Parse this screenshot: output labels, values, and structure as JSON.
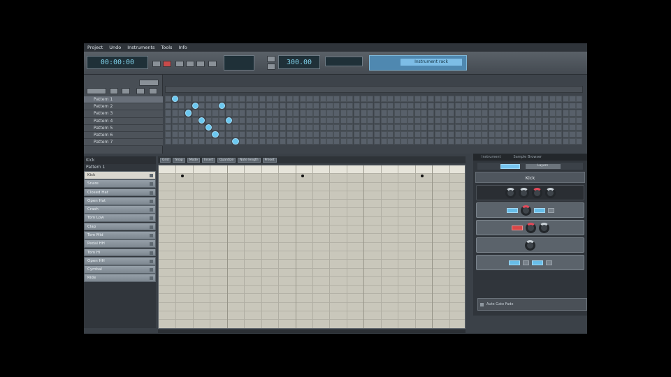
{
  "menu": [
    "Project",
    "Undo",
    "Instruments",
    "Tools",
    "Info"
  ],
  "transport": {
    "time": "00:00:00",
    "tempo": "300.00",
    "current_instrument": "Instrument rack"
  },
  "arranger": {
    "patterns": [
      "Pattern 1",
      "Pattern 2",
      "Pattern 3",
      "Pattern 4",
      "Pattern 5",
      "Pattern 6",
      "Pattern 7"
    ],
    "active_cells": [
      [
        0,
        1
      ],
      [
        1,
        4
      ],
      [
        1,
        8
      ],
      [
        2,
        3
      ],
      [
        3,
        5
      ],
      [
        3,
        9
      ],
      [
        4,
        6
      ],
      [
        5,
        7
      ],
      [
        6,
        10
      ]
    ],
    "columns": 62
  },
  "step_editor": {
    "header": "Kick",
    "pattern_label": "Pattern 1",
    "instruments": [
      "Kick",
      "Snare",
      "Closed Hat",
      "Open Hat",
      "Crash",
      "Tom Low",
      "Clap",
      "Tom Mid",
      "Pedal HH",
      "Tom Hi",
      "Open HH",
      "Cymbal",
      "Ride"
    ],
    "toolbar": [
      "Grid",
      "Snap",
      "Mode",
      "Insert",
      "Quantize",
      "Note length",
      "Preset"
    ],
    "notes": [
      [
        0,
        1
      ],
      [
        0,
        8
      ],
      [
        0,
        15
      ]
    ],
    "steps": 18
  },
  "instrument_panel": {
    "tabs": [
      "Instrument",
      "Sample Browser"
    ],
    "sub_tab": "Layers",
    "name": "Kick",
    "auto_label": "Auto Gate Fade"
  },
  "colors": {
    "accent": "#6cc8f0",
    "grid_bg": "#c9c7bb",
    "panel_bg": "#3b4148"
  }
}
